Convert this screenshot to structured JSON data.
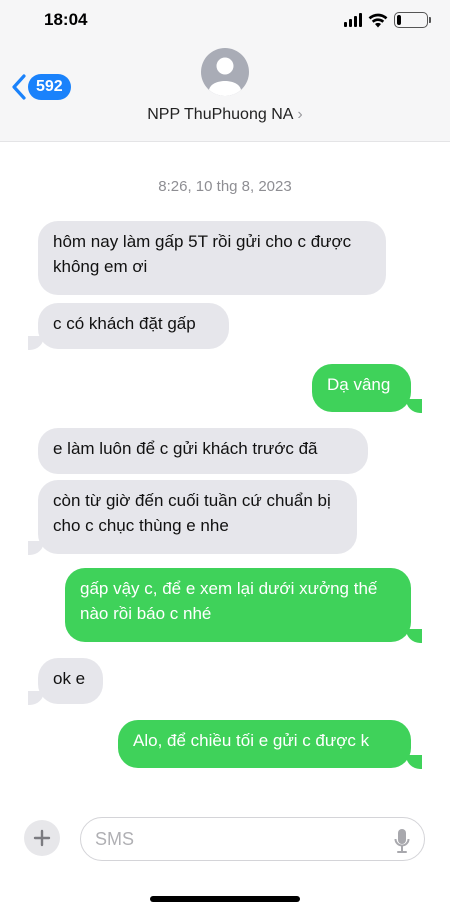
{
  "status_bar": {
    "time": "18:04",
    "signal_icon": "signal-bars-icon",
    "wifi_icon": "wifi-icon",
    "battery_icon": "battery-icon",
    "battery_level": 0.15
  },
  "header": {
    "back_icon": "chevron-left-icon",
    "unread_count": "592",
    "avatar_icon": "person-avatar-icon",
    "contact_name": "NPP ThuPhuong NA",
    "contact_chevron": "›"
  },
  "conversation": {
    "timestamp": "8:26, 10 thg 8, 2023",
    "messages": [
      {
        "direction": "incoming",
        "text": "hôm nay làm gấp 5T rồi gửi cho c được không em ơi"
      },
      {
        "direction": "incoming",
        "text": "c có khách đặt gấp"
      },
      {
        "direction": "outgoing",
        "text": "Dạ vâng"
      },
      {
        "direction": "incoming",
        "text": "e làm luôn để c gửi khách trước đã"
      },
      {
        "direction": "incoming",
        "text": "còn từ giờ đến cuối tuần cứ chuẩn bị cho c chục thùng e nhe"
      },
      {
        "direction": "outgoing",
        "text": "gấp vậy c, để e xem lại dưới xưởng thế nào rồi báo c nhé"
      },
      {
        "direction": "incoming",
        "text": "ok e"
      },
      {
        "direction": "outgoing",
        "text": "Alo, để chiều tối e gửi c được k"
      }
    ]
  },
  "composer": {
    "plus_icon": "plus-icon",
    "placeholder": "SMS",
    "mic_icon": "microphone-icon"
  },
  "colors": {
    "incoming_bubble": "#e6e6eb",
    "outgoing_bubble": "#3fd25a",
    "accent": "#1a82fb"
  }
}
